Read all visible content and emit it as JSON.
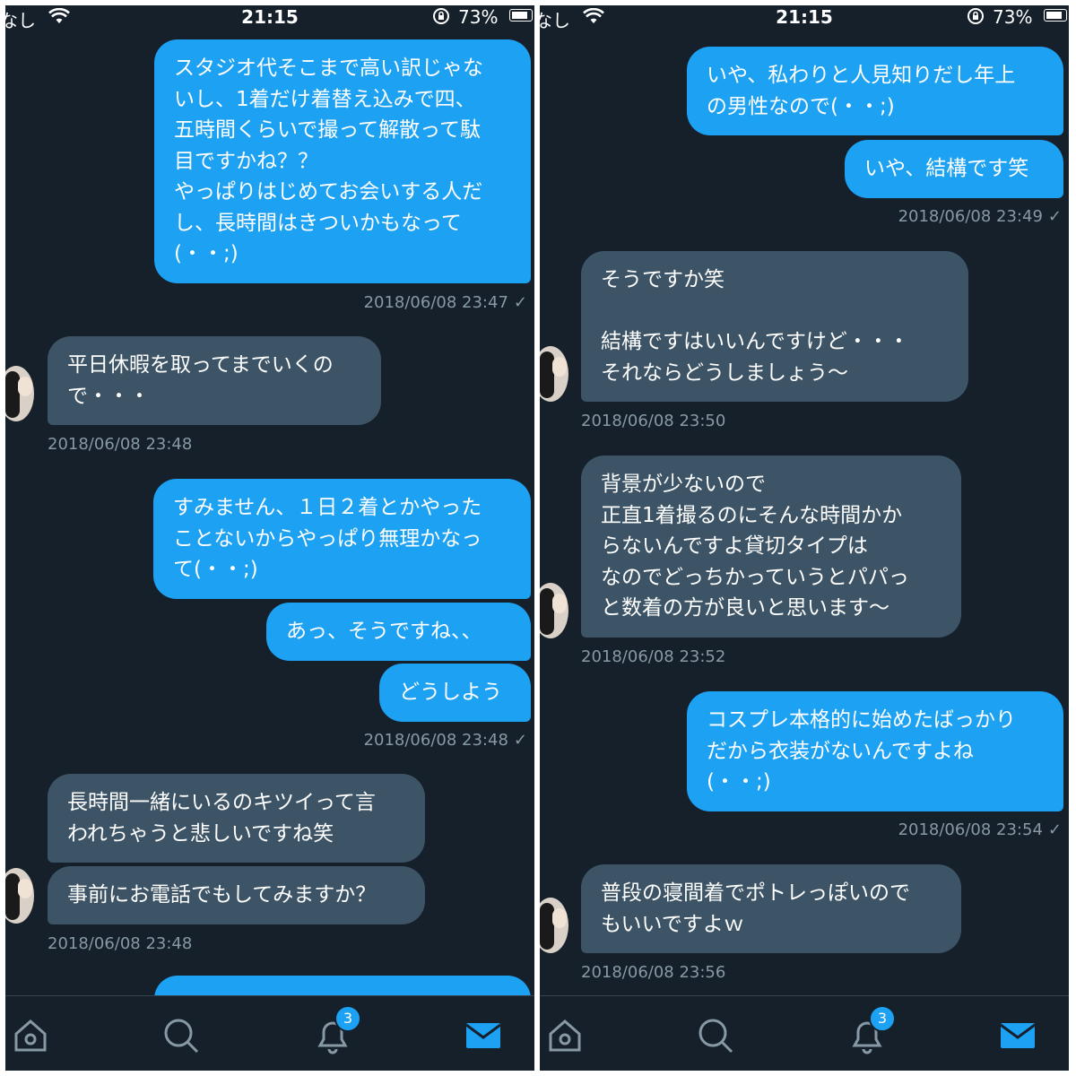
{
  "status": {
    "carrier": "なし",
    "time": "21:15",
    "battery": "73%",
    "battery_level": 0.73
  },
  "colors": {
    "background": "#15202b",
    "sent_bubble": "#1da1f2",
    "received_bubble": "#3d5466",
    "timestamp": "#8899a6"
  },
  "left": {
    "messages": [
      {
        "type": "sent",
        "text": "スタジオ代そこまで高い訳じゃな\nいし、1着だけ着替え込みで四、\n五時間くらいで撮って解散って駄\n目ですかね？？\nやっぱりはじめてお会いする人だ\nし、長時間はきついかもなって\n(・・;)"
      },
      {
        "type": "time",
        "text": "2018/06/08 23:47",
        "check": "✓"
      },
      {
        "type": "recv",
        "text": "平日休暇を取ってまでいくの\nで・・・"
      },
      {
        "type": "time",
        "text": "2018/06/08 23:48"
      },
      {
        "type": "sent",
        "text": "すみません、１日２着とかやった\nことないからやっぱり無理かなっ\nて(・・;)"
      },
      {
        "type": "sent",
        "text": "あっ、そうですね、、"
      },
      {
        "type": "sent",
        "text": "どうしよう"
      },
      {
        "type": "time",
        "text": "2018/06/08 23:48",
        "check": "✓"
      },
      {
        "type": "recv",
        "text": "長時間一緒にいるのキツイって言\nわれちゃうと悲しいですね笑"
      },
      {
        "type": "recv",
        "text": "事前にお電話でもしてみますか？"
      },
      {
        "type": "time",
        "text": "2018/06/08 23:48"
      }
    ]
  },
  "right": {
    "messages": [
      {
        "type": "sent",
        "text": "いや、私わりと人見知りだし年上\nの男性なので(・・;)"
      },
      {
        "type": "sent",
        "text": "いや、結構です笑"
      },
      {
        "type": "time",
        "text": "2018/06/08 23:49",
        "check": "✓"
      },
      {
        "type": "recv",
        "text": "そうですか笑\n\n結構ですはいいんですけど・・・\nそれならどうしましょう〜"
      },
      {
        "type": "time",
        "text": "2018/06/08 23:50"
      },
      {
        "type": "recv",
        "text": "背景が少ないので\n正直1着撮るのにそんな時間かか\nらないんですよ貸切タイプは\nなのでどっちかっていうとパパっ\nと数着の方が良いと思います〜"
      },
      {
        "type": "time",
        "text": "2018/06/08 23:52"
      },
      {
        "type": "sent",
        "text": "コスプレ本格的に始めたばっかり\nだから衣装がないんですよね\n(・・;)"
      },
      {
        "type": "time",
        "text": "2018/06/08 23:54",
        "check": "✓"
      },
      {
        "type": "recv",
        "text": "普段の寝間着でポトレっぽいので\nもいいですよｗ"
      },
      {
        "type": "time",
        "text": "2018/06/08 23:56"
      }
    ]
  },
  "tabs": {
    "items": [
      "home-icon",
      "search-icon",
      "notifications-icon",
      "messages-icon"
    ],
    "notification_count": "3"
  }
}
